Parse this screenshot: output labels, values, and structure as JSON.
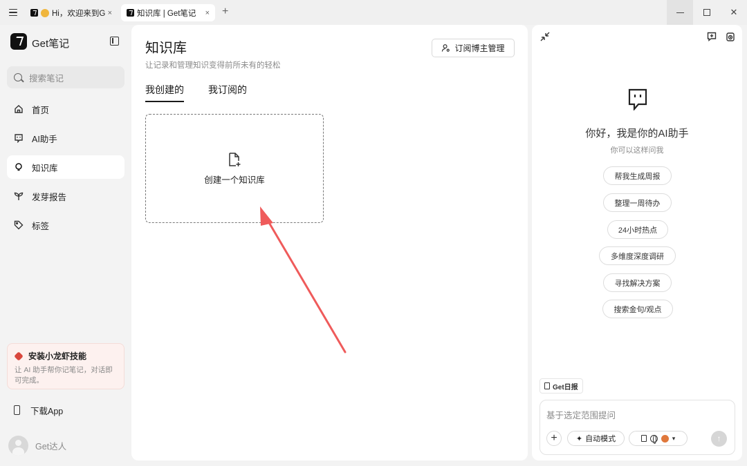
{
  "titlebar": {
    "tabs": [
      {
        "label": "Hi，欢迎来到Ge",
        "close": "×"
      },
      {
        "label": "知识库 | Get笔记",
        "close": "×"
      }
    ],
    "new_tab": "+",
    "close_window": "✕"
  },
  "sidebar": {
    "brand": "Get笔记",
    "search_placeholder": "搜索笔记",
    "items": [
      {
        "label": "首页",
        "icon": "home-icon"
      },
      {
        "label": "AI助手",
        "icon": "chat-bot-icon"
      },
      {
        "label": "知识库",
        "icon": "bulb-icon",
        "active": true
      },
      {
        "label": "发芽报告",
        "icon": "sprout-icon"
      },
      {
        "label": "标签",
        "icon": "tag-icon"
      }
    ],
    "promo": {
      "title": "安装小龙虾技能",
      "description": "让 AI 助手帮你记笔记，对话即可完成。"
    },
    "download": "下载App",
    "user": "Get达人"
  },
  "main": {
    "title": "知识库",
    "subtitle": "让记录和管理知识变得前所未有的轻松",
    "subscribe_button": "订阅博主管理",
    "tabs": [
      "我创建的",
      "我订阅的"
    ],
    "create_card": "创建一个知识库"
  },
  "assistant": {
    "greeting": "你好，我是你的AI助手",
    "sub": "你可以这样问我",
    "suggestions": [
      "帮我生成周报",
      "整理一周待办",
      "24小时热点",
      "多维度深度调研",
      "寻找解决方案",
      "搜索金句/观点"
    ],
    "daily_chip": "Get日报",
    "input_placeholder": "基于选定范围提问",
    "add": "+",
    "mode": "自动模式",
    "dropdown": "▾",
    "send": "↑"
  }
}
